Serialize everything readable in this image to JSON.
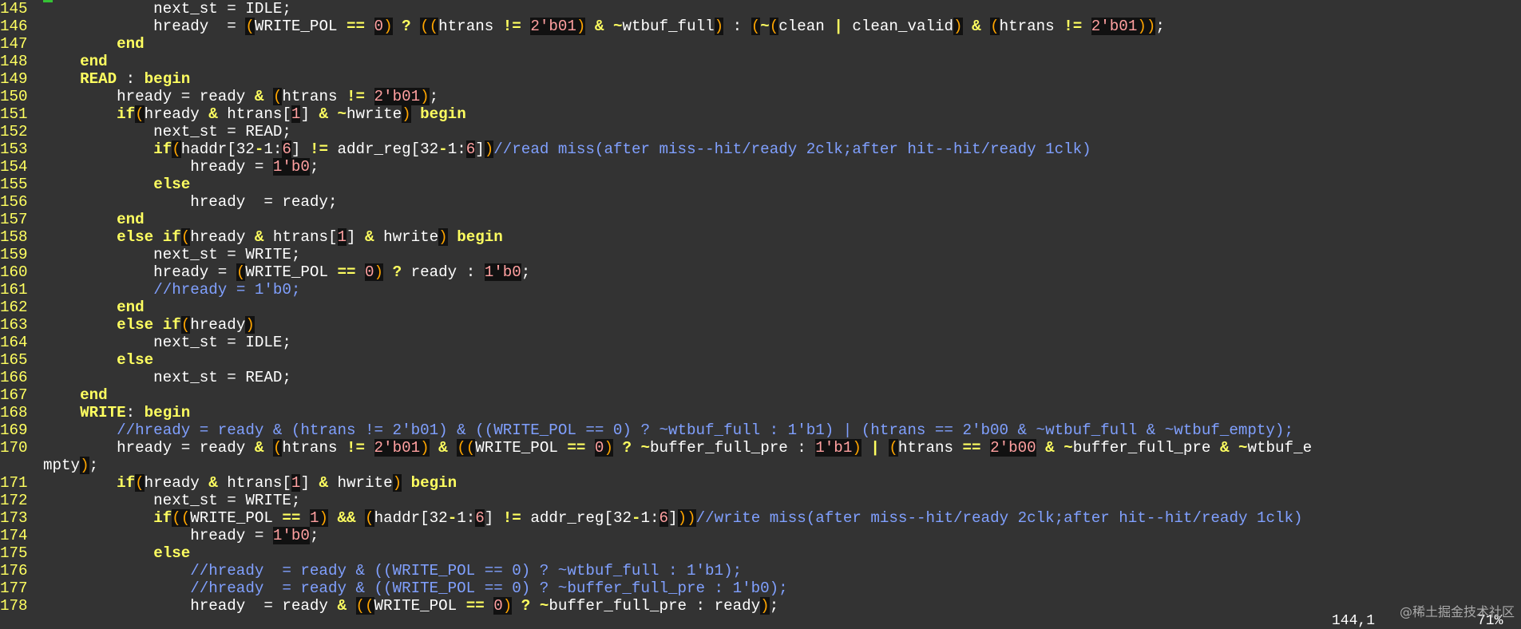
{
  "editor": {
    "lines": [
      {
        "no": "145",
        "tokens": [
          [
            "t",
            "            next_st = IDLE;"
          ]
        ]
      },
      {
        "no": "146",
        "tokens": [
          [
            "t",
            "            hready  = "
          ],
          [
            "p",
            "("
          ],
          [
            "t",
            "WRITE_POL "
          ],
          [
            "o",
            "=="
          ],
          [
            "t",
            " "
          ],
          [
            "n",
            "0"
          ],
          [
            "p",
            ")"
          ],
          [
            "t",
            " "
          ],
          [
            "o",
            "?"
          ],
          [
            "t",
            " "
          ],
          [
            "p",
            "(("
          ],
          [
            "t",
            "htrans "
          ],
          [
            "o",
            "!="
          ],
          [
            "t",
            " "
          ],
          [
            "n",
            "2'b01"
          ],
          [
            "p",
            ")"
          ],
          [
            "t",
            " "
          ],
          [
            "o",
            "&"
          ],
          [
            "t",
            " "
          ],
          [
            "o",
            "~"
          ],
          [
            "t",
            "wtbuf_full"
          ],
          [
            "p",
            ")"
          ],
          [
            "t",
            " : "
          ],
          [
            "p",
            "("
          ],
          [
            "o",
            "~"
          ],
          [
            "p",
            "("
          ],
          [
            "t",
            "clean "
          ],
          [
            "o",
            "|"
          ],
          [
            "t",
            " clean_valid"
          ],
          [
            "p",
            ")"
          ],
          [
            "t",
            " "
          ],
          [
            "o",
            "&"
          ],
          [
            "t",
            " "
          ],
          [
            "p",
            "("
          ],
          [
            "t",
            "htrans "
          ],
          [
            "o",
            "!="
          ],
          [
            "t",
            " "
          ],
          [
            "n",
            "2'b01"
          ],
          [
            "p",
            "))"
          ],
          [
            "t",
            ";"
          ]
        ]
      },
      {
        "no": "147",
        "tokens": [
          [
            "t",
            "        "
          ],
          [
            "k",
            "end"
          ]
        ]
      },
      {
        "no": "148",
        "tokens": [
          [
            "t",
            "    "
          ],
          [
            "k",
            "end"
          ]
        ]
      },
      {
        "no": "149",
        "tokens": [
          [
            "t",
            "    "
          ],
          [
            "k",
            "READ"
          ],
          [
            "t",
            " : "
          ],
          [
            "k",
            "begin"
          ]
        ]
      },
      {
        "no": "150",
        "tokens": [
          [
            "t",
            "        hready = ready "
          ],
          [
            "o",
            "&"
          ],
          [
            "t",
            " "
          ],
          [
            "p",
            "("
          ],
          [
            "t",
            "htrans "
          ],
          [
            "o",
            "!="
          ],
          [
            "t",
            " "
          ],
          [
            "n",
            "2'b01"
          ],
          [
            "p",
            ")"
          ],
          [
            "t",
            ";"
          ]
        ]
      },
      {
        "no": "151",
        "tokens": [
          [
            "t",
            "        "
          ],
          [
            "k",
            "if"
          ],
          [
            "p",
            "("
          ],
          [
            "t",
            "hready "
          ],
          [
            "o",
            "&"
          ],
          [
            "t",
            " htrans["
          ],
          [
            "n",
            "1"
          ],
          [
            "t",
            "] "
          ],
          [
            "o",
            "&"
          ],
          [
            "t",
            " "
          ],
          [
            "o",
            "~"
          ],
          [
            "t",
            "hwrite"
          ],
          [
            "p",
            ")"
          ],
          [
            "t",
            " "
          ],
          [
            "k",
            "begin"
          ]
        ]
      },
      {
        "no": "152",
        "tokens": [
          [
            "t",
            "            next_st = READ;"
          ]
        ]
      },
      {
        "no": "153",
        "tokens": [
          [
            "t",
            "            "
          ],
          [
            "k",
            "if"
          ],
          [
            "p",
            "("
          ],
          [
            "t",
            "haddr[32"
          ],
          [
            "o",
            "-"
          ],
          [
            "t",
            "1:"
          ],
          [
            "n",
            "6"
          ],
          [
            "t",
            "] "
          ],
          [
            "o",
            "!="
          ],
          [
            "t",
            " addr_reg[32"
          ],
          [
            "o",
            "-"
          ],
          [
            "t",
            "1:"
          ],
          [
            "n",
            "6"
          ],
          [
            "t",
            "]"
          ],
          [
            "p",
            ")"
          ],
          [
            "c",
            "//read miss(after miss--hit/ready 2clk;after hit--hit/ready 1clk)"
          ]
        ]
      },
      {
        "no": "154",
        "tokens": [
          [
            "t",
            "                hready = "
          ],
          [
            "n",
            "1'b0"
          ],
          [
            "t",
            ";"
          ]
        ]
      },
      {
        "no": "155",
        "tokens": [
          [
            "t",
            "            "
          ],
          [
            "k",
            "else"
          ]
        ]
      },
      {
        "no": "156",
        "tokens": [
          [
            "t",
            "                hready  = ready;"
          ]
        ]
      },
      {
        "no": "157",
        "tokens": [
          [
            "t",
            "        "
          ],
          [
            "k",
            "end"
          ]
        ]
      },
      {
        "no": "158",
        "tokens": [
          [
            "t",
            "        "
          ],
          [
            "k",
            "else if"
          ],
          [
            "p",
            "("
          ],
          [
            "t",
            "hready "
          ],
          [
            "o",
            "&"
          ],
          [
            "t",
            " htrans["
          ],
          [
            "n",
            "1"
          ],
          [
            "t",
            "] "
          ],
          [
            "o",
            "&"
          ],
          [
            "t",
            " hwrite"
          ],
          [
            "p",
            ")"
          ],
          [
            "t",
            " "
          ],
          [
            "k",
            "begin"
          ]
        ]
      },
      {
        "no": "159",
        "tokens": [
          [
            "t",
            "            next_st = WRITE;"
          ]
        ]
      },
      {
        "no": "160",
        "tokens": [
          [
            "t",
            "            hready = "
          ],
          [
            "p",
            "("
          ],
          [
            "t",
            "WRITE_POL "
          ],
          [
            "o",
            "=="
          ],
          [
            "t",
            " "
          ],
          [
            "n",
            "0"
          ],
          [
            "p",
            ")"
          ],
          [
            "t",
            " "
          ],
          [
            "o",
            "?"
          ],
          [
            "t",
            " ready : "
          ],
          [
            "n",
            "1'b0"
          ],
          [
            "t",
            ";"
          ]
        ]
      },
      {
        "no": "161",
        "tokens": [
          [
            "t",
            "            "
          ],
          [
            "c",
            "//hready = 1'b0;"
          ]
        ]
      },
      {
        "no": "162",
        "tokens": [
          [
            "t",
            "        "
          ],
          [
            "k",
            "end"
          ]
        ]
      },
      {
        "no": "163",
        "tokens": [
          [
            "t",
            "        "
          ],
          [
            "k",
            "else if"
          ],
          [
            "p",
            "("
          ],
          [
            "t",
            "hready"
          ],
          [
            "p",
            ")"
          ]
        ]
      },
      {
        "no": "164",
        "tokens": [
          [
            "t",
            "            next_st = IDLE;"
          ]
        ]
      },
      {
        "no": "165",
        "tokens": [
          [
            "t",
            "        "
          ],
          [
            "k",
            "else"
          ]
        ]
      },
      {
        "no": "166",
        "tokens": [
          [
            "t",
            "            next_st = READ;"
          ]
        ]
      },
      {
        "no": "167",
        "tokens": [
          [
            "t",
            "    "
          ],
          [
            "k",
            "end"
          ]
        ]
      },
      {
        "no": "168",
        "tokens": [
          [
            "t",
            "    "
          ],
          [
            "k",
            "WRITE"
          ],
          [
            "t",
            ": "
          ],
          [
            "k",
            "begin"
          ]
        ]
      },
      {
        "no": "169",
        "tokens": [
          [
            "t",
            "        "
          ],
          [
            "c",
            "//hready = ready & (htrans != 2'b01) & ((WRITE_POL == 0) ? ~wtbuf_full : 1'b1) | (htrans == 2'b00 & ~wtbuf_full & ~wtbuf_empty);"
          ]
        ]
      },
      {
        "no": "170",
        "tokens": [
          [
            "t",
            "        hready = ready "
          ],
          [
            "o",
            "&"
          ],
          [
            "t",
            " "
          ],
          [
            "p",
            "("
          ],
          [
            "t",
            "htrans "
          ],
          [
            "o",
            "!="
          ],
          [
            "t",
            " "
          ],
          [
            "n",
            "2'b01"
          ],
          [
            "p",
            ")"
          ],
          [
            "t",
            " "
          ],
          [
            "o",
            "&"
          ],
          [
            "t",
            " "
          ],
          [
            "p",
            "(("
          ],
          [
            "t",
            "WRITE_POL "
          ],
          [
            "o",
            "=="
          ],
          [
            "t",
            " "
          ],
          [
            "n",
            "0"
          ],
          [
            "p",
            ")"
          ],
          [
            "t",
            " "
          ],
          [
            "o",
            "?"
          ],
          [
            "t",
            " "
          ],
          [
            "o",
            "~"
          ],
          [
            "t",
            "buffer_full_pre : "
          ],
          [
            "n",
            "1'b1"
          ],
          [
            "p",
            ")"
          ],
          [
            "t",
            " "
          ],
          [
            "o",
            "|"
          ],
          [
            "t",
            " "
          ],
          [
            "p",
            "("
          ],
          [
            "t",
            "htrans "
          ],
          [
            "o",
            "=="
          ],
          [
            "t",
            " "
          ],
          [
            "n",
            "2'b00"
          ],
          [
            "t",
            " "
          ],
          [
            "o",
            "&"
          ],
          [
            "t",
            " "
          ],
          [
            "o",
            "~"
          ],
          [
            "t",
            "buffer_full_pre "
          ],
          [
            "o",
            "&"
          ],
          [
            "t",
            " "
          ],
          [
            "o",
            "~"
          ],
          [
            "t",
            "wtbuf_e"
          ]
        ]
      },
      {
        "no": "",
        "tokens": [
          [
            "t",
            "mpty"
          ],
          [
            "p",
            ")"
          ],
          [
            "t",
            ";"
          ]
        ]
      },
      {
        "no": "171",
        "tokens": [
          [
            "t",
            "        "
          ],
          [
            "k",
            "if"
          ],
          [
            "p",
            "("
          ],
          [
            "t",
            "hready "
          ],
          [
            "o",
            "&"
          ],
          [
            "t",
            " htrans["
          ],
          [
            "n",
            "1"
          ],
          [
            "t",
            "] "
          ],
          [
            "o",
            "&"
          ],
          [
            "t",
            " hwrite"
          ],
          [
            "p",
            ")"
          ],
          [
            "t",
            " "
          ],
          [
            "k",
            "begin"
          ]
        ]
      },
      {
        "no": "172",
        "tokens": [
          [
            "t",
            "            next_st = WRITE;"
          ]
        ]
      },
      {
        "no": "173",
        "tokens": [
          [
            "t",
            "            "
          ],
          [
            "k",
            "if"
          ],
          [
            "p",
            "(("
          ],
          [
            "t",
            "WRITE_POL "
          ],
          [
            "o",
            "=="
          ],
          [
            "t",
            " "
          ],
          [
            "n",
            "1"
          ],
          [
            "p",
            ")"
          ],
          [
            "t",
            " "
          ],
          [
            "o",
            "&&"
          ],
          [
            "t",
            " "
          ],
          [
            "p",
            "("
          ],
          [
            "t",
            "haddr[32"
          ],
          [
            "o",
            "-"
          ],
          [
            "t",
            "1:"
          ],
          [
            "n",
            "6"
          ],
          [
            "t",
            "] "
          ],
          [
            "o",
            "!="
          ],
          [
            "t",
            " addr_reg[32"
          ],
          [
            "o",
            "-"
          ],
          [
            "t",
            "1:"
          ],
          [
            "n",
            "6"
          ],
          [
            "t",
            "]"
          ],
          [
            "p",
            "))"
          ],
          [
            "c",
            "//write miss(after miss--hit/ready 2clk;after hit--hit/ready 1clk)"
          ]
        ]
      },
      {
        "no": "174",
        "tokens": [
          [
            "t",
            "                hready = "
          ],
          [
            "n",
            "1'b0"
          ],
          [
            "t",
            ";"
          ]
        ]
      },
      {
        "no": "175",
        "tokens": [
          [
            "t",
            "            "
          ],
          [
            "k",
            "else"
          ]
        ]
      },
      {
        "no": "176",
        "tokens": [
          [
            "t",
            "                "
          ],
          [
            "c",
            "//hready  = ready & ((WRITE_POL == 0) ? ~wtbuf_full : 1'b1);"
          ]
        ]
      },
      {
        "no": "177",
        "tokens": [
          [
            "t",
            "                "
          ],
          [
            "c",
            "//hready  = ready & ((WRITE_POL == 0) ? ~buffer_full_pre : 1'b0);"
          ]
        ]
      },
      {
        "no": "178",
        "tokens": [
          [
            "t",
            "                hready  = ready "
          ],
          [
            "o",
            "&"
          ],
          [
            "t",
            " "
          ],
          [
            "p",
            "(("
          ],
          [
            "t",
            "WRITE_POL "
          ],
          [
            "o",
            "=="
          ],
          [
            "t",
            " "
          ],
          [
            "n",
            "0"
          ],
          [
            "p",
            ")"
          ],
          [
            "t",
            " "
          ],
          [
            "o",
            "?"
          ],
          [
            "t",
            " "
          ],
          [
            "o",
            "~"
          ],
          [
            "t",
            "buffer_full_pre : ready"
          ],
          [
            "p",
            ")"
          ],
          [
            "t",
            ";"
          ]
        ]
      }
    ]
  },
  "ruler": {
    "position": "144,1",
    "percent": "71%"
  },
  "watermark": "@稀土掘金技术社区",
  "colors": {
    "background": "#333333",
    "line_number": "#ffff60",
    "keyword": "#ffff60",
    "number": "#ffa0a0",
    "paren": "#ffa500",
    "comment": "#80a0ff",
    "text": "#ffffff"
  }
}
